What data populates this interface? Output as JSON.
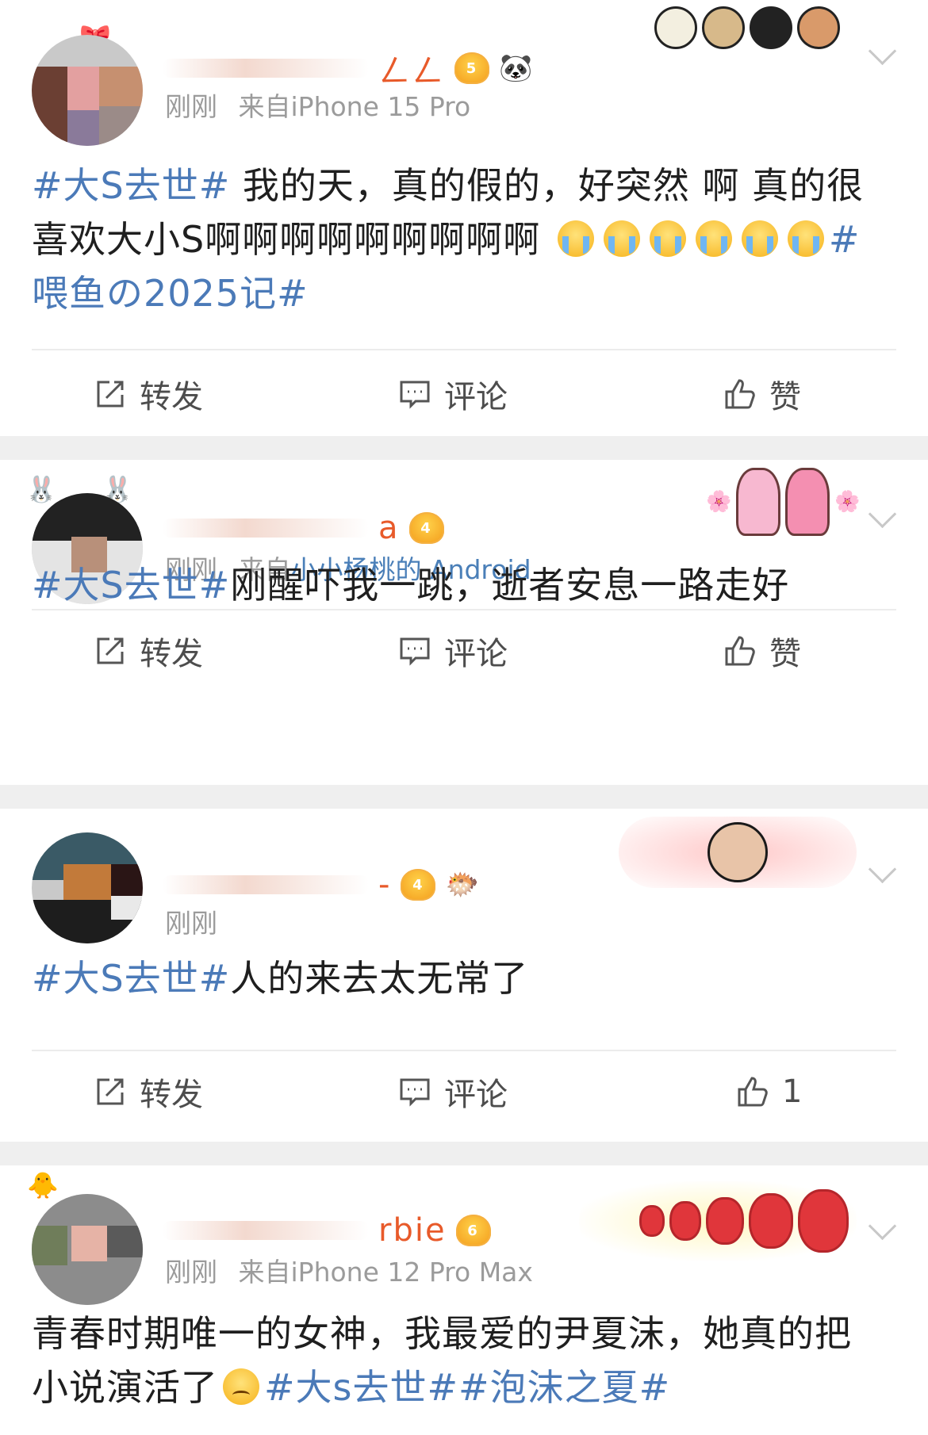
{
  "colors": {
    "hashtag": "#4b7ab8",
    "meta_gray": "#9b9b9b",
    "username": "#e85a2a",
    "separator": "#efefef"
  },
  "actions": {
    "repost_label": "转发",
    "comment_label": "评论",
    "like_label": "赞"
  },
  "posts": [
    {
      "username_visible": "ㄥㄥ",
      "vip_level": "5",
      "time": "刚刚",
      "via": "来自",
      "device": "iPhone 15 Pro",
      "content": [
        {
          "type": "tag",
          "text": "#大S去世#"
        },
        {
          "type": "text",
          "text": " 我的天，真的假的，好突然 啊 真的很喜欢大小S啊啊啊啊啊啊啊啊啊 "
        },
        {
          "type": "emoji",
          "name": "crying-emoji"
        },
        {
          "type": "emoji",
          "name": "crying-emoji"
        },
        {
          "type": "emoji",
          "name": "crying-emoji"
        },
        {
          "type": "emoji",
          "name": "crying-emoji"
        },
        {
          "type": "emoji",
          "name": "crying-emoji"
        },
        {
          "type": "emoji",
          "name": "crying-emoji"
        },
        {
          "type": "tag",
          "text": "#喂鱼の2025记#"
        }
      ],
      "like_count": ""
    },
    {
      "username_visible": "a",
      "vip_level": "4",
      "time": "刚刚",
      "via": "来自",
      "device": "小小杨桃的 Android",
      "content": [
        {
          "type": "tag",
          "text": "#大S去世#"
        },
        {
          "type": "text",
          "text": "刚醒吓我一跳，逝者安息一路走好"
        }
      ],
      "like_count": ""
    },
    {
      "username_visible": "-",
      "vip_level": "4",
      "time": "刚刚",
      "via": "",
      "device": "",
      "content": [
        {
          "type": "tag",
          "text": "#大S去世#"
        },
        {
          "type": "text",
          "text": "人的来去太无常了"
        }
      ],
      "like_count": "1"
    },
    {
      "username_visible": "rbie",
      "vip_level": "6",
      "time": "刚刚",
      "via": "来自",
      "device": "iPhone 12 Pro Max",
      "content": [
        {
          "type": "text",
          "text": "青春时期唯一的女神，我最爱的尹夏沫，她真的把小说演活了"
        },
        {
          "type": "emoji",
          "name": "sad-emoji"
        },
        {
          "type": "tag",
          "text": "#大s去世##泡沫之夏#"
        }
      ],
      "like_count": ""
    }
  ]
}
